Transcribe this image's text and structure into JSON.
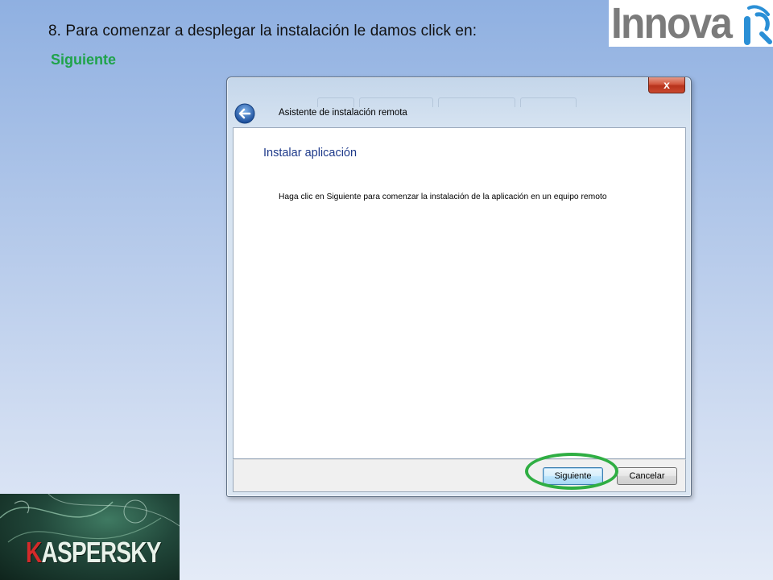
{
  "slide": {
    "step_text": "8. Para comenzar a desplegar la instalación le damos click en:",
    "action_text": "Siguiente"
  },
  "logos": {
    "innova": {
      "text": "Innova",
      "icon": "innova-swirl-icon"
    },
    "kaspersky": {
      "text": "ASPERSKY",
      "initial": "K"
    }
  },
  "window": {
    "close_label": "x",
    "title": "Asistente de instalación remota",
    "heading": "Instalar aplicación",
    "description": "Haga clic en Siguiente para comenzar la instalación de la aplicación en un equipo remoto",
    "buttons": {
      "next": "Siguiente",
      "cancel": "Cancelar"
    }
  },
  "colors": {
    "action_text": "#1fa34a",
    "highlight": "#2fae43",
    "heading": "#1e3a8a"
  }
}
